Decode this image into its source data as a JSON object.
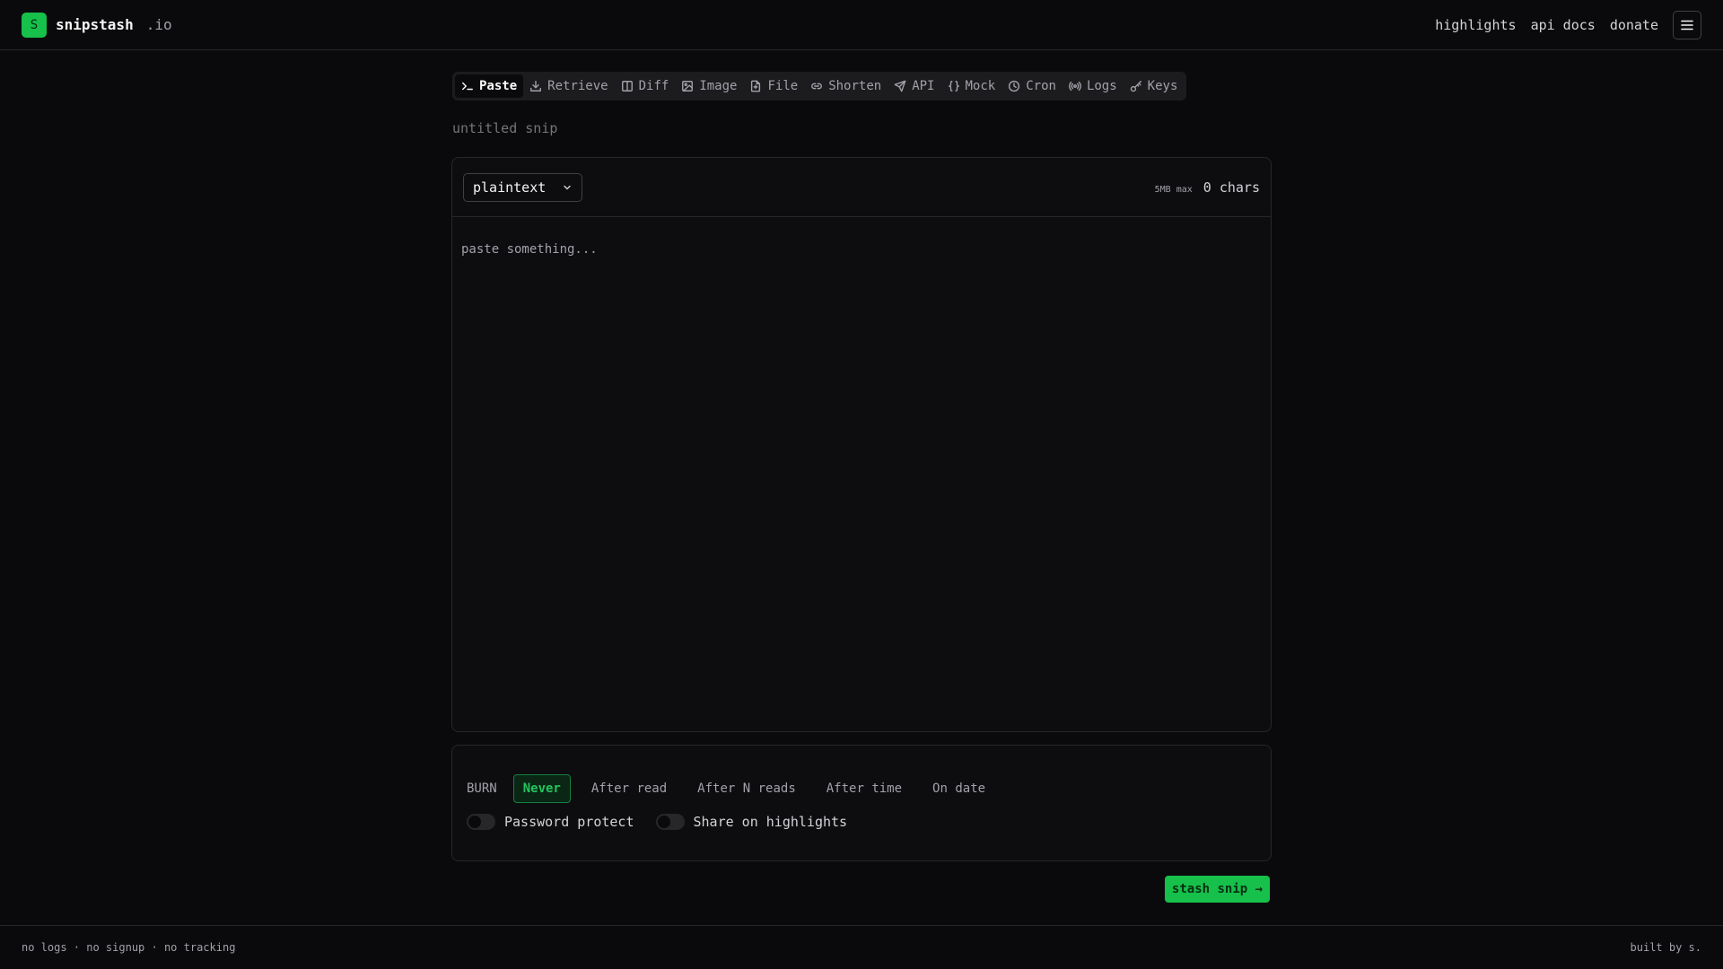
{
  "brand": {
    "logo_letter": "S",
    "name": "snipstash",
    "tld": ".io",
    "accent": "#16c04a"
  },
  "nav": {
    "highlights": "highlights",
    "api_docs": "api docs",
    "donate": "donate",
    "menu_icon": "menu-icon"
  },
  "tabs": [
    {
      "label": "Paste",
      "icon": "terminal-icon",
      "active": true
    },
    {
      "label": "Retrieve",
      "icon": "download-icon"
    },
    {
      "label": "Diff",
      "icon": "columns-icon"
    },
    {
      "label": "Image",
      "icon": "image-icon"
    },
    {
      "label": "File",
      "icon": "file-icon"
    },
    {
      "label": "Shorten",
      "icon": "link-icon"
    },
    {
      "label": "API",
      "icon": "send-icon"
    },
    {
      "label": "Mock",
      "icon": "braces-icon"
    },
    {
      "label": "Cron",
      "icon": "clock-icon"
    },
    {
      "label": "Logs",
      "icon": "radio-icon"
    },
    {
      "label": "Keys",
      "icon": "key-icon"
    }
  ],
  "snip": {
    "title_placeholder": "untitled snip"
  },
  "editor": {
    "language": "plaintext",
    "size_limit": "5MB max",
    "char_count": "0 chars",
    "placeholder": "paste something..."
  },
  "burn": {
    "label": "BURN",
    "options": [
      "Never",
      "After read",
      "After N reads",
      "After time",
      "On date"
    ],
    "selected": "Never"
  },
  "toggles": {
    "password": "Password protect",
    "share": "Share on highlights"
  },
  "submit": {
    "label": "stash snip →"
  },
  "footer": {
    "left": "no logs · no signup · no tracking",
    "right": "built by s."
  }
}
